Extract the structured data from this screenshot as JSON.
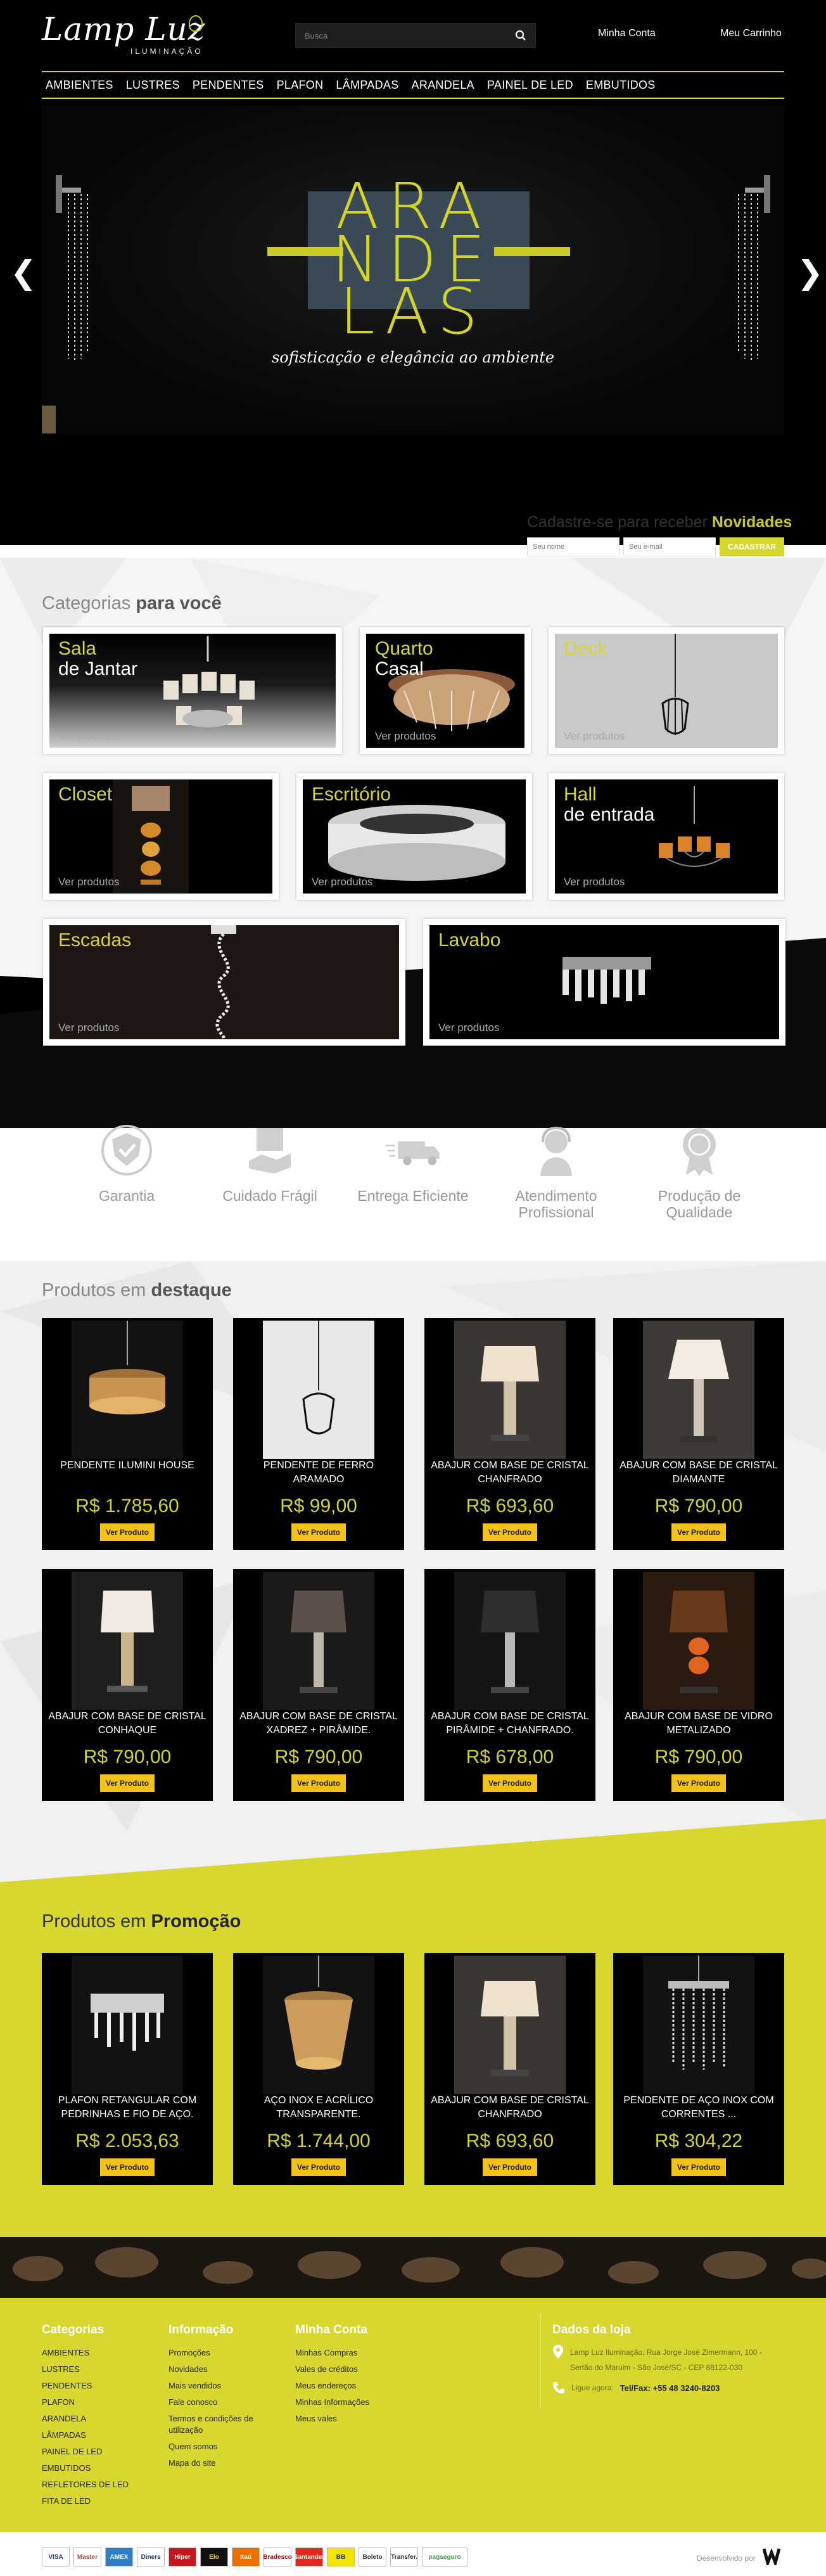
{
  "header": {
    "logo_text": "Lamp Luz",
    "logo_sub": "ILUMINAÇÃO",
    "search_placeholder": "Busca",
    "account_link": "Minha Conta",
    "cart_link": "Meu Carrinho"
  },
  "nav": [
    "AMBIENTES",
    "LUSTRES",
    "PENDENTES",
    "PLAFON",
    "LÂMPADAS",
    "ARANDELA",
    "PAINEL DE LED",
    "EMBUTIDOS"
  ],
  "banner": {
    "lines": [
      "ARA",
      "NDE",
      "LAS"
    ],
    "subtitle": "sofisticação e elegância ao ambiente",
    "prev": "❮",
    "next": "❯"
  },
  "newsletter": {
    "title": "Cadastre-se para receber",
    "title_highlight": "Novidades",
    "name_placeholder": "Seu nome",
    "email_placeholder": "Seu e-mail",
    "button": "CADASTRAR"
  },
  "categories": {
    "title": "Categorias",
    "title_bold": "para você",
    "items": [
      {
        "t1": "Sala",
        "t2": "de Jantar",
        "see": "Ver produtos"
      },
      {
        "t1": "Quarto",
        "t2": "Casal",
        "see": "Ver produtos"
      },
      {
        "t1": "Deck",
        "t2": "",
        "see": "Ver produtos"
      },
      {
        "t1": "Closet",
        "t2": "",
        "see": "Ver produtos"
      },
      {
        "t1": "Escritório",
        "t2": "",
        "see": "Ver produtos"
      },
      {
        "t1": "Hall",
        "t2": "de entrada",
        "see": "Ver produtos"
      },
      {
        "t1": "Escadas",
        "t2": "",
        "see": "Ver produtos"
      },
      {
        "t1": "Lavabo",
        "t2": "",
        "see": "Ver produtos"
      }
    ]
  },
  "features": [
    {
      "label": "Garantia",
      "icon": "shield-check-icon"
    },
    {
      "label": "Cuidado Frágil",
      "icon": "fragile-box-icon"
    },
    {
      "label": "Entrega Eficiente",
      "icon": "delivery-truck-icon"
    },
    {
      "label": "Atendimento Profissional",
      "icon": "support-agent-icon"
    },
    {
      "label": "Produção de Qualidade",
      "icon": "quality-badge-icon"
    }
  ],
  "featured": {
    "title": "Produtos em",
    "title_bold": "destaque",
    "items": [
      {
        "name": "PENDENTE ILUMINI HOUSE",
        "price": "R$ 1.785,60",
        "button": "Ver Produto"
      },
      {
        "name": "PENDENTE DE FERRO ARAMADO",
        "price": "R$ 99,00",
        "button": "Ver Produto"
      },
      {
        "name": "ABAJUR COM BASE DE CRISTAL CHANFRADO",
        "price": "R$ 693,60",
        "button": "Ver Produto"
      },
      {
        "name": "ABAJUR COM BASE DE CRISTAL DIAMANTE",
        "price": "R$ 790,00",
        "button": "Ver Produto"
      },
      {
        "name": "ABAJUR COM BASE DE CRISTAL CONHAQUE",
        "price": "R$ 790,00",
        "button": "Ver Produto"
      },
      {
        "name": "ABAJUR COM BASE DE CRISTAL XADREZ + PIRÂMIDE.",
        "price": "R$ 790,00",
        "button": "Ver Produto"
      },
      {
        "name": "ABAJUR COM BASE DE CRISTAL PIRÂMIDE + CHANFRADO.",
        "price": "R$ 678,00",
        "button": "Ver Produto"
      },
      {
        "name": "ABAJUR COM BASE DE VIDRO METALIZADO",
        "price": "R$ 790,00",
        "button": "Ver Produto"
      }
    ]
  },
  "promo": {
    "title": "Produtos em",
    "title_bold": "Promoção",
    "items": [
      {
        "name": "PLAFON RETANGULAR COM PEDRINHAS E FIO DE AÇO.",
        "price": "R$ 2.053,63",
        "button": "Ver Produto"
      },
      {
        "name": "AÇO INOX E ACRÍLICO TRANSPARENTE.",
        "price": "R$ 1.744,00",
        "button": "Ver Produto"
      },
      {
        "name": "ABAJUR COM BASE DE CRISTAL CHANFRADO",
        "price": "R$ 693,60",
        "button": "Ver Produto"
      },
      {
        "name": "PENDENTE DE AÇO INOX COM CORRENTES ...",
        "price": "R$ 304,22",
        "button": "Ver Produto"
      }
    ]
  },
  "footer": {
    "cols": [
      {
        "title": "Categorias",
        "items": [
          "AMBIENTES",
          "LUSTRES",
          "PENDENTES",
          "PLAFON",
          "ARANDELA",
          "LÂMPADAS",
          "PAINEL DE LED",
          "EMBUTIDOS",
          "REFLETORES DE LED",
          "FITA DE LED"
        ]
      },
      {
        "title": "Informação",
        "items": [
          "Promoções",
          "Novidades",
          "Mais vendidos",
          "Fale conosco",
          "Termos e condições de utilização",
          "Quem somos",
          "Mapa do site"
        ]
      },
      {
        "title": "Minha Conta",
        "items": [
          "Minhas Compras",
          "Vales de créditos",
          "Meus endereços",
          "Minhas Informações",
          "Meus vales"
        ]
      }
    ],
    "store": {
      "title": "Dados da loja",
      "address": "Lamp Luz Iluminação, Rua Jorge José Zimermann, 100 - Sertão do Maruim - São José/SC - CEP 88122-030",
      "phone_label": "Ligue agora:",
      "phone": "Tel/Fax: +55 48 3240-8203"
    },
    "payments": [
      "VISA",
      "Master",
      "AMEX",
      "Diners",
      "Hiper",
      "Elo",
      "Itaú",
      "Bradesco",
      "Santander",
      "BB",
      "Boleto",
      "Transfer.",
      "pagseguro"
    ],
    "dev_label": "Desenvolvido por"
  },
  "colors": {
    "accent": "#d3d22f",
    "button": "#f2c21a",
    "promo_bg": "#d8d72f",
    "dark": "#000000"
  }
}
